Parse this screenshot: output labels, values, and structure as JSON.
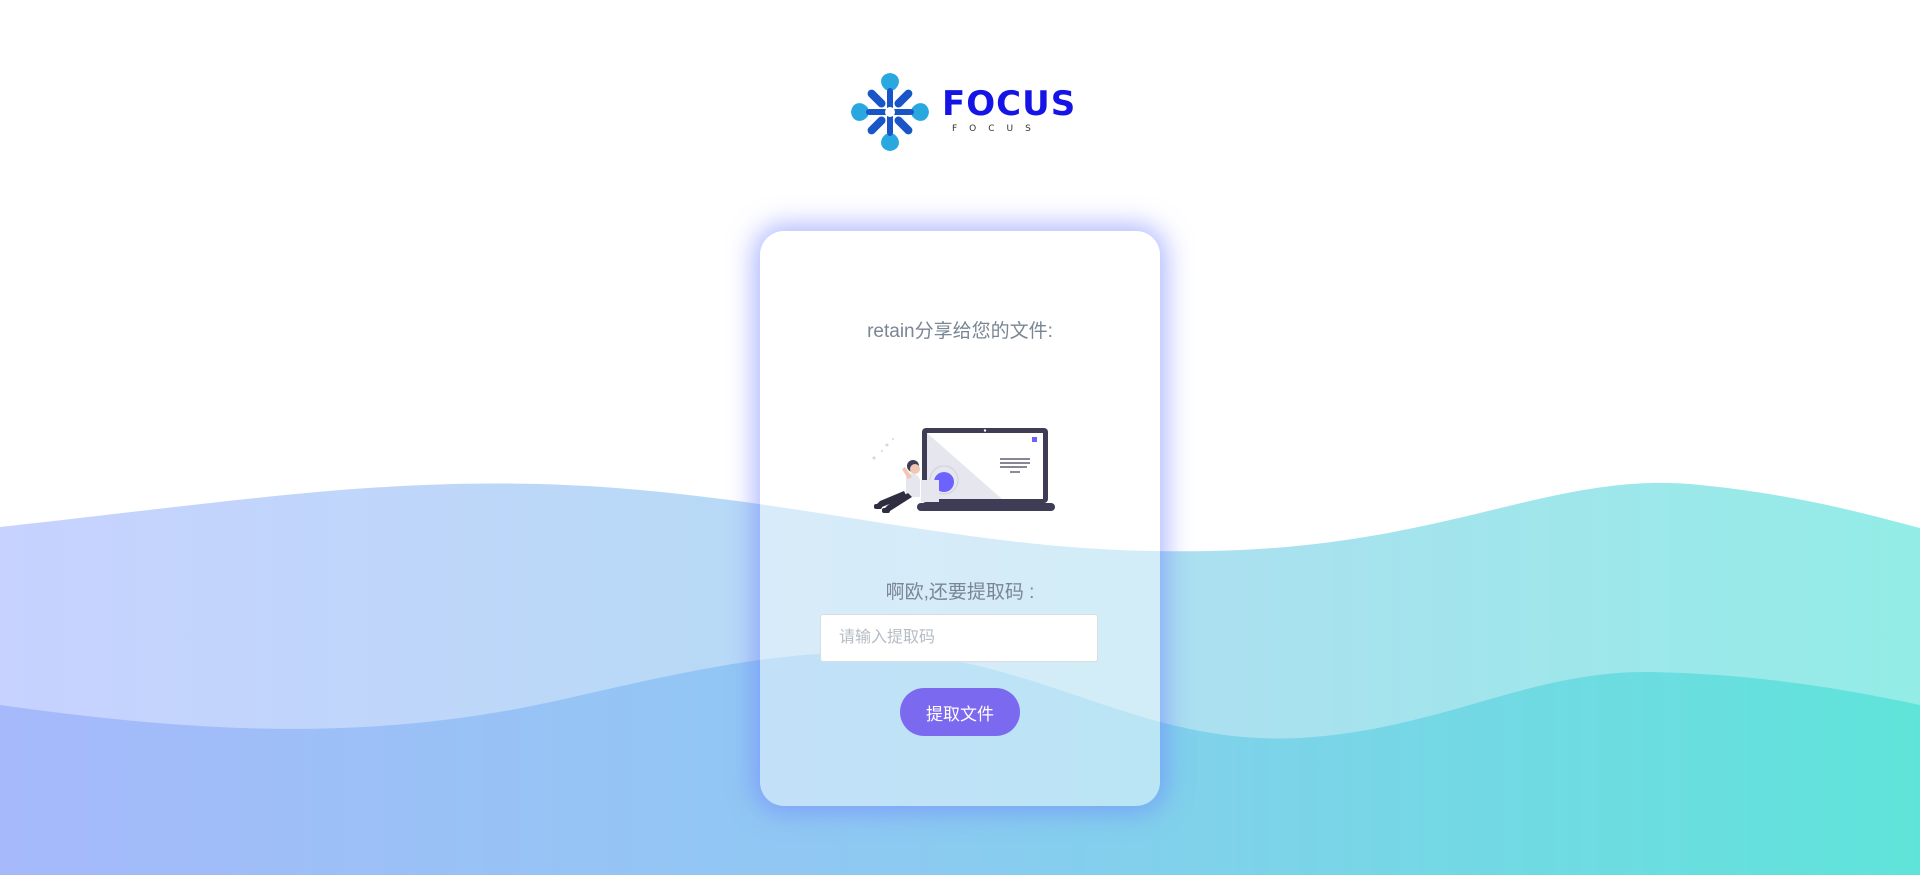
{
  "logo": {
    "word": "FOCUS",
    "sub": "FOCUS"
  },
  "card": {
    "share_text": "retain分享给您的文件:",
    "prompt_text": "啊欧,还要提取码 :",
    "input_placeholder": "请输入提取码",
    "input_value": "",
    "submit_label": "提取文件"
  },
  "colors": {
    "accent": "#7b6af0",
    "logo_blue": "#1414e6",
    "logo_light": "#29a8e0",
    "logo_dark": "#1a55c7",
    "wave_left": "#a9b8fb",
    "wave_right": "#5fe3dc"
  }
}
